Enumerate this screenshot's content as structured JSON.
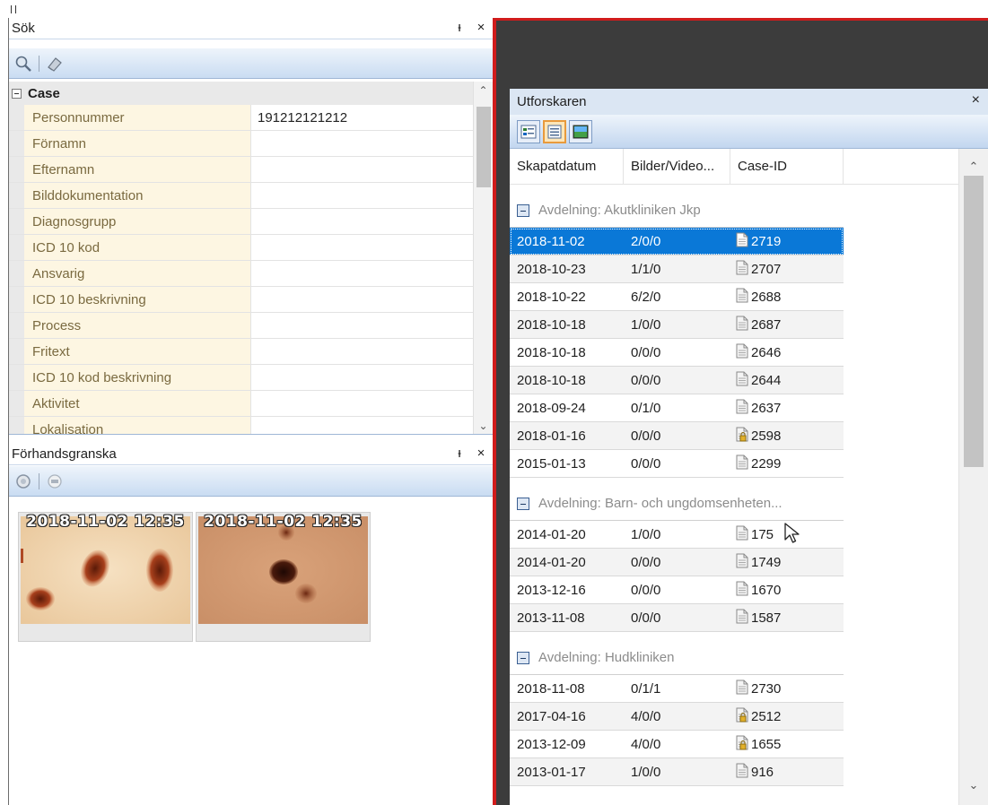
{
  "search_panel": {
    "title": "Sök",
    "pin_glyph": "ᵻ",
    "close_glyph": "×",
    "toolbar_icons": [
      "search-icon",
      "eraser-icon"
    ],
    "category": "Case",
    "fields": [
      {
        "label": "Personnummer",
        "value": "191212121212"
      },
      {
        "label": "Förnamn",
        "value": ""
      },
      {
        "label": "Efternamn",
        "value": ""
      },
      {
        "label": "Bilddokumentation",
        "value": ""
      },
      {
        "label": "Diagnosgrupp",
        "value": ""
      },
      {
        "label": "ICD 10 kod",
        "value": ""
      },
      {
        "label": "Ansvarig",
        "value": ""
      },
      {
        "label": "ICD 10 beskrivning",
        "value": ""
      },
      {
        "label": "Process",
        "value": ""
      },
      {
        "label": "Fritext",
        "value": ""
      },
      {
        "label": "ICD 10 kod beskrivning",
        "value": ""
      },
      {
        "label": "Aktivitet",
        "value": ""
      },
      {
        "label": "Lokalisation",
        "value": ""
      }
    ]
  },
  "preview_panel": {
    "title": "Förhandsgranska",
    "pin_glyph": "ᵻ",
    "close_glyph": "×",
    "thumbnails": [
      {
        "timestamp": "2018-11-02 12:35"
      },
      {
        "timestamp": "2018-11-02 12:35"
      }
    ]
  },
  "explorer": {
    "title": "Utforskaren",
    "close_glyph": "×",
    "columns": [
      "Skapatdatum",
      "Bilder/Video...",
      "Case-ID"
    ],
    "groups": [
      {
        "label": "Avdelning: Akutkliniken Jkp",
        "rows": [
          {
            "date": "2018-11-02",
            "media": "2/0/0",
            "case_id": "2719",
            "locked": false,
            "selected": true
          },
          {
            "date": "2018-10-23",
            "media": "1/1/0",
            "case_id": "2707",
            "locked": false
          },
          {
            "date": "2018-10-22",
            "media": "6/2/0",
            "case_id": "2688",
            "locked": false
          },
          {
            "date": "2018-10-18",
            "media": "1/0/0",
            "case_id": "2687",
            "locked": false
          },
          {
            "date": "2018-10-18",
            "media": "0/0/0",
            "case_id": "2646",
            "locked": false
          },
          {
            "date": "2018-10-18",
            "media": "0/0/0",
            "case_id": "2644",
            "locked": false
          },
          {
            "date": "2018-09-24",
            "media": "0/1/0",
            "case_id": "2637",
            "locked": false
          },
          {
            "date": "2018-01-16",
            "media": "0/0/0",
            "case_id": "2598",
            "locked": true
          },
          {
            "date": "2015-01-13",
            "media": "0/0/0",
            "case_id": "2299",
            "locked": false
          }
        ]
      },
      {
        "label": "Avdelning: Barn- och ungdomsenheten...",
        "rows": [
          {
            "date": "2014-01-20",
            "media": "1/0/0",
            "case_id": "175",
            "locked": false
          },
          {
            "date": "2014-01-20",
            "media": "0/0/0",
            "case_id": "1749",
            "locked": false
          },
          {
            "date": "2013-12-16",
            "media": "0/0/0",
            "case_id": "1670",
            "locked": false
          },
          {
            "date": "2013-11-08",
            "media": "0/0/0",
            "case_id": "1587",
            "locked": false
          }
        ]
      },
      {
        "label": "Avdelning: Hudkliniken",
        "rows": [
          {
            "date": "2018-11-08",
            "media": "0/1/1",
            "case_id": "2730",
            "locked": false
          },
          {
            "date": "2017-04-16",
            "media": "4/0/0",
            "case_id": "2512",
            "locked": true
          },
          {
            "date": "2013-12-09",
            "media": "4/0/0",
            "case_id": "1655",
            "locked": true
          },
          {
            "date": "2013-01-17",
            "media": "1/0/0",
            "case_id": "916",
            "locked": false
          }
        ]
      }
    ],
    "view_buttons": [
      "details-view-icon",
      "list-view-icon",
      "thumbnail-view-icon"
    ]
  },
  "colors": {
    "selection": "#0a78d7",
    "accent_red": "#d01c1c",
    "key_background": "#fdf6e2"
  }
}
